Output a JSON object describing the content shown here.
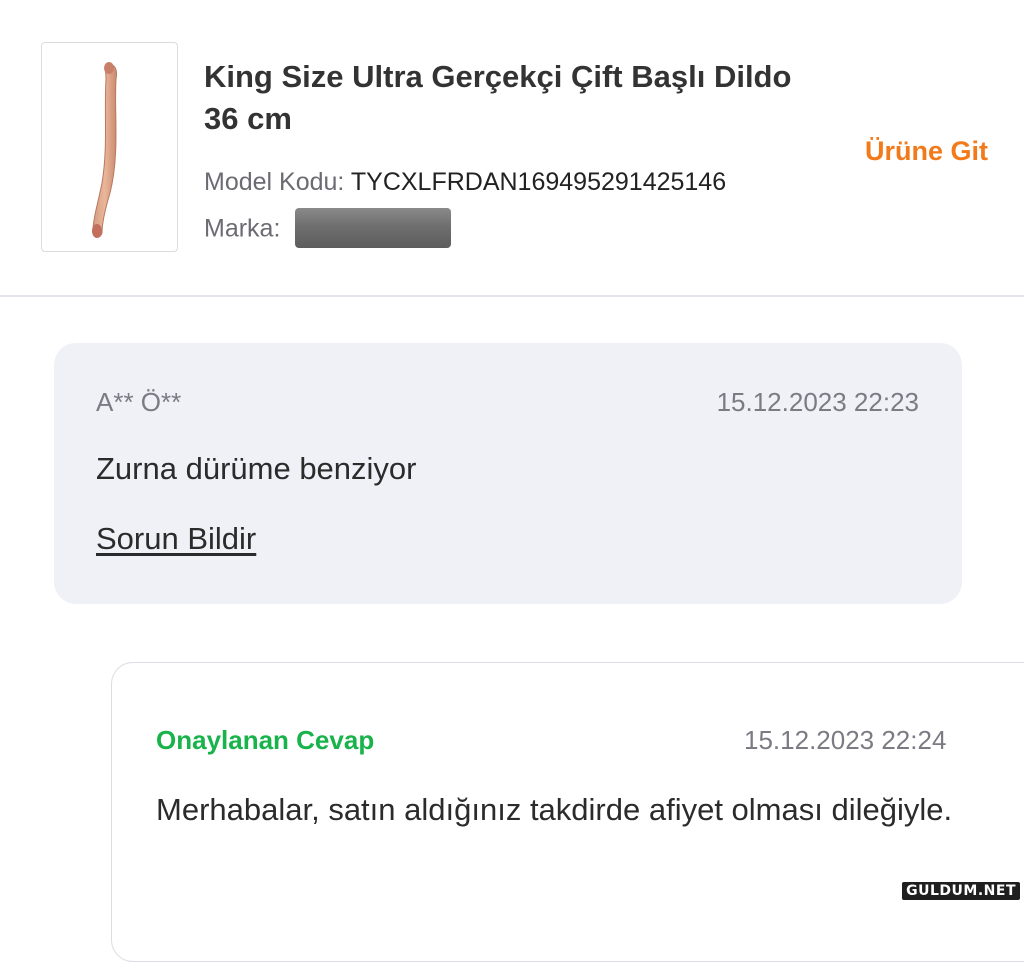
{
  "product": {
    "title": "King Size Ultra Gerçekçi Çift Başlı Dildo 36 cm",
    "model_label": "Model Kodu:",
    "model_code": "TYCXLFRDAN169495291425146",
    "brand_label": "Marka:",
    "go_to_product": "Ürüne Git"
  },
  "question": {
    "author": "A** Ö**",
    "date": "15.12.2023 22:23",
    "text": "Zurna dürüme benziyor",
    "report_link": "Sorun Bildir"
  },
  "answer": {
    "label": "Onaylanan Cevap",
    "date": "15.12.2023 22:24",
    "text": "Merhabalar, satın aldığınız takdirde afiyet olması dileğiyle."
  },
  "watermark": "GULDUM.NET",
  "colors": {
    "accent_orange": "#f27a1a",
    "approved_green": "#19b34b",
    "question_bg": "#f0f1f7"
  }
}
